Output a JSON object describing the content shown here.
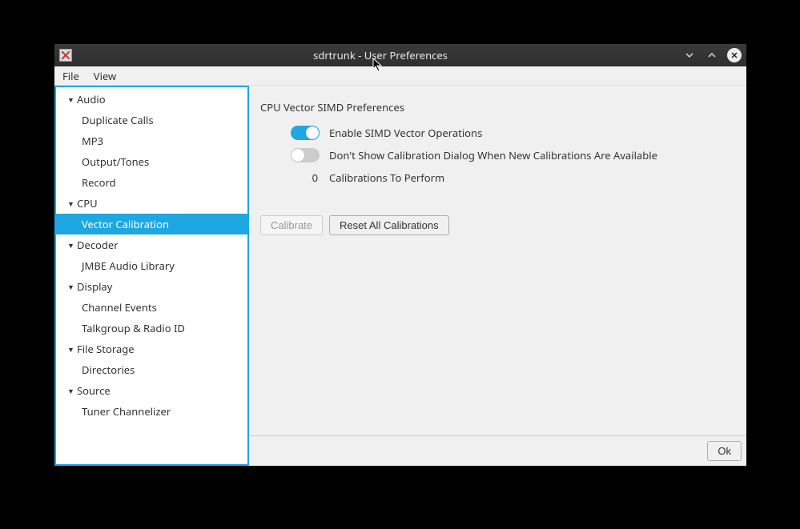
{
  "window": {
    "title": "sdrtrunk - User Preferences"
  },
  "menubar": {
    "file": "File",
    "view": "View"
  },
  "sidebar": {
    "categories": [
      {
        "label": "Audio",
        "items": [
          "Duplicate Calls",
          "MP3",
          "Output/Tones",
          "Record"
        ]
      },
      {
        "label": "CPU",
        "items": [
          "Vector Calibration"
        ],
        "selected_item": "Vector Calibration"
      },
      {
        "label": "Decoder",
        "items": [
          "JMBE Audio Library"
        ]
      },
      {
        "label": "Display",
        "items": [
          "Channel Events",
          "Talkgroup & Radio ID"
        ]
      },
      {
        "label": "File Storage",
        "items": [
          "Directories"
        ]
      },
      {
        "label": "Source",
        "items": [
          "Tuner Channelizer"
        ]
      }
    ]
  },
  "main": {
    "section_title": "CPU Vector SIMD Preferences",
    "enable_simd": {
      "label": "Enable SIMD Vector Operations",
      "enabled": true
    },
    "hide_calibration_dialog": {
      "label": "Don't Show Calibration Dialog When New Calibrations Are Available",
      "enabled": false
    },
    "calibrations_count": 0,
    "calibrations_label": "Calibrations To Perform",
    "calibrate_button": "Calibrate",
    "reset_button": "Reset All Calibrations"
  },
  "footer": {
    "ok_button": "Ok"
  }
}
